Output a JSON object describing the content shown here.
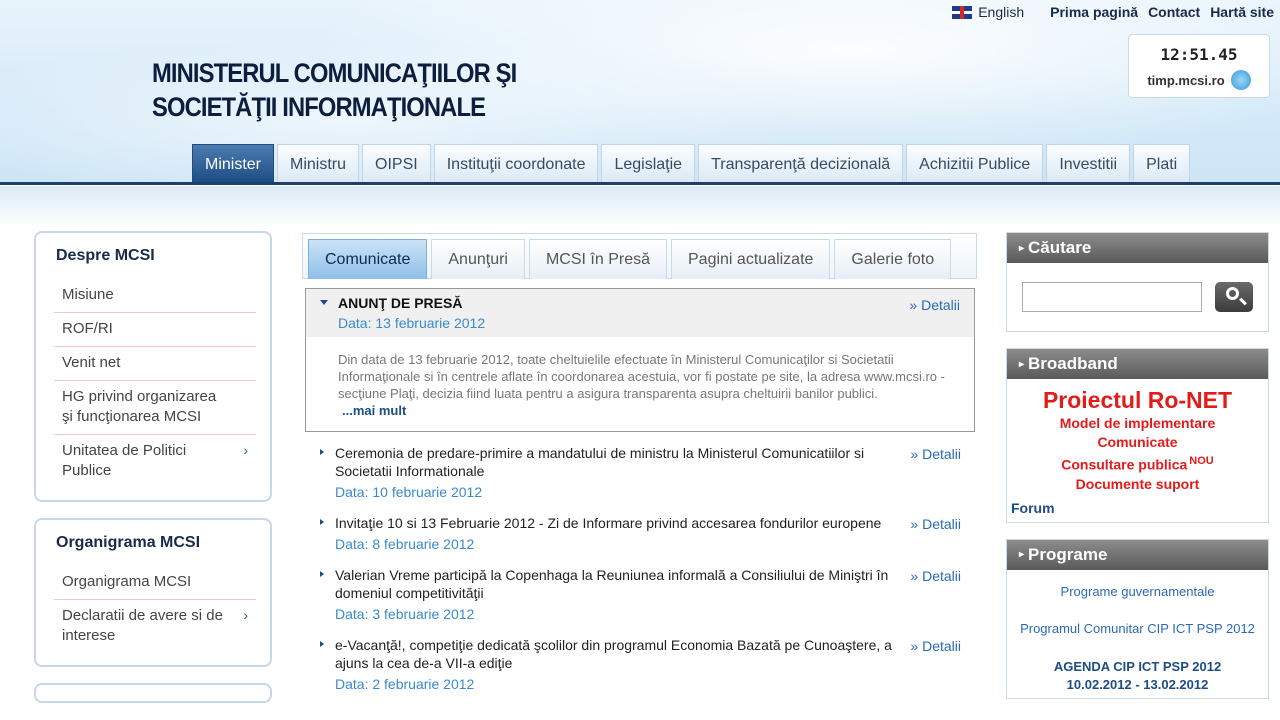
{
  "header": {
    "site_title_line1": "MINISTERUL COMUNICAŢIILOR ŞI",
    "site_title_line2": "SOCIETĂŢII INFORMAŢIONALE",
    "top_links": {
      "language": "English",
      "home": "Prima pagină",
      "contact": "Contact",
      "sitemap": "Hartă site"
    },
    "clock": {
      "time": "12:51.45",
      "site": "timp.mcsi.ro"
    }
  },
  "nav": {
    "tabs": [
      {
        "label": "Minister"
      },
      {
        "label": "Ministru"
      },
      {
        "label": "OIPSI"
      },
      {
        "label": "Instituţii coordonate"
      },
      {
        "label": "Legislaţie"
      },
      {
        "label": "Transparenţă decizională"
      },
      {
        "label": "Achizitii Publice"
      },
      {
        "label": "Investitii"
      },
      {
        "label": "Plati"
      }
    ],
    "active_index": 0
  },
  "sidebar": {
    "despre": {
      "title": "Despre MCSI",
      "items": [
        {
          "label": "Misiune"
        },
        {
          "label": "ROF/RI"
        },
        {
          "label": "Venit net"
        },
        {
          "label": "HG privind organizarea şi funcţionarea MCSI"
        },
        {
          "label": "Unitatea de Politici Publice"
        }
      ]
    },
    "organigrama": {
      "title": "Organigrama MCSI",
      "items": [
        {
          "label": "Organigrama MCSI"
        },
        {
          "label": "Declaratii de avere si de interese"
        }
      ]
    }
  },
  "content": {
    "tabs": [
      {
        "label": "Comunicate"
      },
      {
        "label": "Anunţuri"
      },
      {
        "label": "MCSI în Presă"
      },
      {
        "label": "Pagini actualizate"
      },
      {
        "label": "Galerie foto"
      }
    ],
    "active_tab": 0,
    "details_label": "» Detalii",
    "featured": {
      "title": "ANUNŢ DE PRESĂ",
      "date": "Data: 13 februarie 2012",
      "body": "Din data de 13 februarie 2012, toate cheltuielile efectuate în Ministerul Comunicaţilor si Societatii Informaţionale si în centrele aflate în coordonarea acestuia, vor fi postate pe site, la adresa www.mcsi.ro - secţiune Plaţi, decizia fiind luata pentru a asigura transparenta asupra cheltuirii banilor publici.",
      "more": "...mai mult"
    },
    "news": [
      {
        "title": "Ceremonia de predare-primire a mandatului de ministru la Ministerul Comunicatiilor si Societatii Informationale",
        "date": "Data: 10 februarie 2012"
      },
      {
        "title": "Invitaţie 10 si 13 Februarie 2012 - Zi de Informare privind accesarea fondurilor europene",
        "date": "Data: 8 februarie 2012"
      },
      {
        "title": "Valerian Vreme participă la Copenhaga la Reuniunea informală a Consiliului de Miniştri în domeniul competitivităţii",
        "date": "Data: 3 februarie 2012"
      },
      {
        "title": "e-Vacanţă!, competiţie dedicată şcolilor din programul Economia Bazată pe Cunoaştere, a ajuns la cea de-a VII-a ediţie",
        "date": "Data: 2 februarie 2012"
      }
    ]
  },
  "right": {
    "search": {
      "title": "Căutare",
      "value": ""
    },
    "broadband": {
      "title": "Broadband",
      "headline": "Proiectul Ro-NET",
      "line1": "Model de implementare",
      "line2": "Comunicate",
      "line3": "Consultare publica",
      "nou": "NOU",
      "line4": "Documente suport",
      "forum": "Forum"
    },
    "programe": {
      "title": "Programe",
      "link1": "Programe guvernamentale",
      "link2": "Programul Comunitar CIP ICT PSP 2012",
      "agenda_line1": "AGENDA CIP ICT PSP 2012",
      "agenda_line2": "10.02.2012 - 13.02.2012"
    }
  }
}
